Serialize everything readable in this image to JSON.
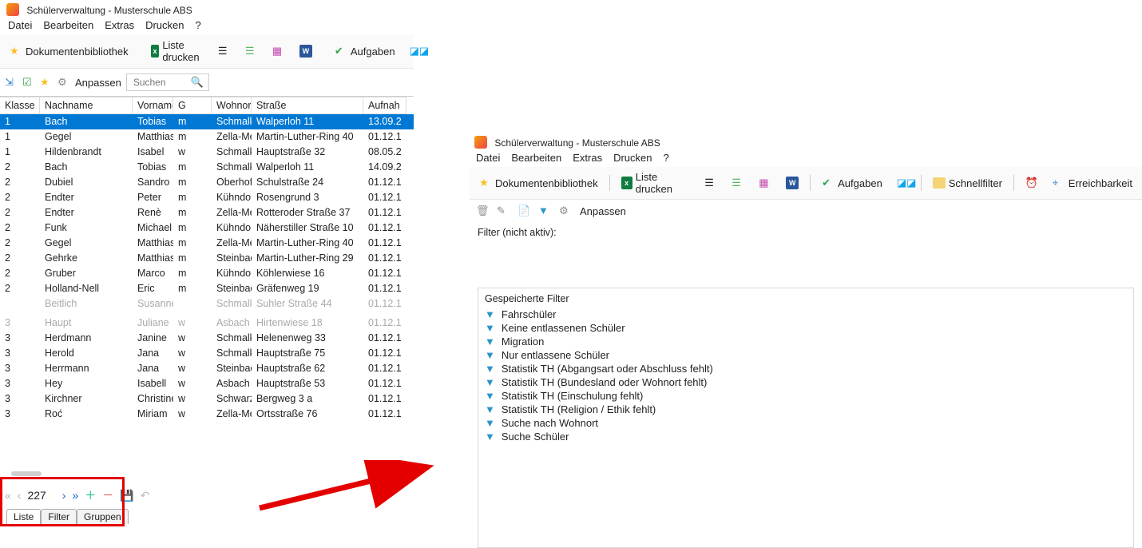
{
  "app": {
    "title": "Schülerverwaltung - Musterschule ABS"
  },
  "menu": {
    "file": "Datei",
    "edit": "Bearbeiten",
    "extras": "Extras",
    "print": "Drucken",
    "help": "?"
  },
  "toolbar": {
    "library": "Dokumentenbibliothek",
    "print_list": "Liste drucken",
    "tasks": "Aufgaben",
    "quickfilter": "Schnellfilter",
    "reachability": "Erreichbarkeit",
    "customize": "Anpassen"
  },
  "search": {
    "placeholder": "Suchen"
  },
  "columns": {
    "klasse": "Klasse",
    "nachname": "Nachname",
    "vorname": "Vorname",
    "g": "G",
    "wohnort": "Wohnort",
    "strasse": "Straße",
    "aufnahme": "Aufnah"
  },
  "rows": [
    {
      "k": "1",
      "nn": "Bach",
      "vn": "Tobias",
      "g": "m",
      "wo": "Schmalk",
      "st": "Walperloh 11",
      "dt": "13.09.2",
      "sel": true
    },
    {
      "k": "1",
      "nn": "Gegel",
      "vn": "Matthias",
      "g": "m",
      "wo": "Zella-Me",
      "st": "Martin-Luther-Ring 40",
      "dt": "01.12.1"
    },
    {
      "k": "1",
      "nn": "Hildenbrandt",
      "vn": "Isabel",
      "g": "w",
      "wo": "Schmalk",
      "st": "Hauptstraße 32",
      "dt": "08.05.2"
    },
    {
      "k": "2",
      "nn": "Bach",
      "vn": "Tobias",
      "g": "m",
      "wo": "Schmalk",
      "st": "Walperloh 11",
      "dt": "14.09.2"
    },
    {
      "k": "2",
      "nn": "Dubiel",
      "vn": "Sandro",
      "g": "m",
      "wo": "Oberhof",
      "st": "Schulstraße 24",
      "dt": "01.12.1"
    },
    {
      "k": "2",
      "nn": "Endter",
      "vn": "Peter",
      "g": "m",
      "wo": "Kühndor",
      "st": "Rosengrund 3",
      "dt": "01.12.1"
    },
    {
      "k": "2",
      "nn": "Endter",
      "vn": "Renè",
      "g": "m",
      "wo": "Zella-Me",
      "st": "Rotteroder Straße 37",
      "dt": "01.12.1"
    },
    {
      "k": "2",
      "nn": "Funk",
      "vn": "Michael",
      "g": "m",
      "wo": "Kühndor",
      "st": "Näherstiller Straße 10",
      "dt": "01.12.1"
    },
    {
      "k": "2",
      "nn": "Gegel",
      "vn": "Matthias",
      "g": "m",
      "wo": "Zella-Me",
      "st": "Martin-Luther-Ring 40",
      "dt": "01.12.1"
    },
    {
      "k": "2",
      "nn": "Gehrke",
      "vn": "Matthias",
      "g": "m",
      "wo": "Steinbac",
      "st": "Martin-Luther-Ring 29",
      "dt": "01.12.1"
    },
    {
      "k": "2",
      "nn": "Gruber",
      "vn": "Marco",
      "g": "m",
      "wo": "Kühndor",
      "st": "Köhlerwiese 16",
      "dt": "01.12.1"
    },
    {
      "k": "2",
      "nn": "Holland-Nell",
      "vn": "Eric",
      "g": "m",
      "wo": "Steinbac",
      "st": "Gräfenweg 19",
      "dt": "01.12.1"
    },
    {
      "k": "",
      "nn": "Beitlich",
      "vn": "Susanne",
      "g": "",
      "wo": "Schmalk",
      "st": "Suhler Straße 44",
      "dt": "01.12.1",
      "faded": true
    },
    {
      "k": "",
      "nn": "",
      "vn": "",
      "g": "",
      "wo": "",
      "st": "",
      "dt": "",
      "faded": true
    },
    {
      "k": "3",
      "nn": "Haupt",
      "vn": "Juliane",
      "g": "w",
      "wo": "Asbach",
      "st": "Hirtenwiese 18",
      "dt": "01.12.1",
      "faded": true
    },
    {
      "k": "3",
      "nn": "Herdmann",
      "vn": "Janine",
      "g": "w",
      "wo": "Schmalk",
      "st": "Helenenweg 33",
      "dt": "01.12.1"
    },
    {
      "k": "3",
      "nn": "Herold",
      "vn": "Jana",
      "g": "w",
      "wo": "Schmalk",
      "st": "Hauptstraße 75",
      "dt": "01.12.1"
    },
    {
      "k": "3",
      "nn": "Herrmann",
      "vn": "Jana",
      "g": "w",
      "wo": "Steinbac",
      "st": "Hauptstraße 62",
      "dt": "01.12.1"
    },
    {
      "k": "3",
      "nn": "Hey",
      "vn": "Isabell",
      "g": "w",
      "wo": "Asbach",
      "st": "Hauptstraße 53",
      "dt": "01.12.1"
    },
    {
      "k": "3",
      "nn": "Kirchner",
      "vn": "Christine",
      "g": "w",
      "wo": "Schwarza",
      "st": "Bergweg 3 a",
      "dt": "01.12.1"
    },
    {
      "k": "3",
      "nn": "Roć",
      "vn": "Miriam",
      "g": "w",
      "wo": "Zella-Me",
      "st": "Ortsstraße 76",
      "dt": "01.12.1"
    }
  ],
  "nav": {
    "count": "227"
  },
  "tabs": {
    "liste": "Liste",
    "filter": "Filter",
    "gruppen": "Gruppen"
  },
  "rp": {
    "filter_label": "Filter (nicht aktiv):",
    "saved_title": "Gespeicherte Filter",
    "filters": [
      "Fahrschüler",
      "Keine entlassenen Schüler",
      "Migration",
      "Nur entlassene Schüler",
      "Statistik TH (Abgangsart oder Abschluss fehlt)",
      "Statistik TH (Bundesland oder Wohnort fehlt)",
      "Statistik TH (Einschulung fehlt)",
      "Statistik TH (Religion / Ethik fehlt)",
      "Suche nach Wohnort",
      "Suche Schüler"
    ]
  }
}
